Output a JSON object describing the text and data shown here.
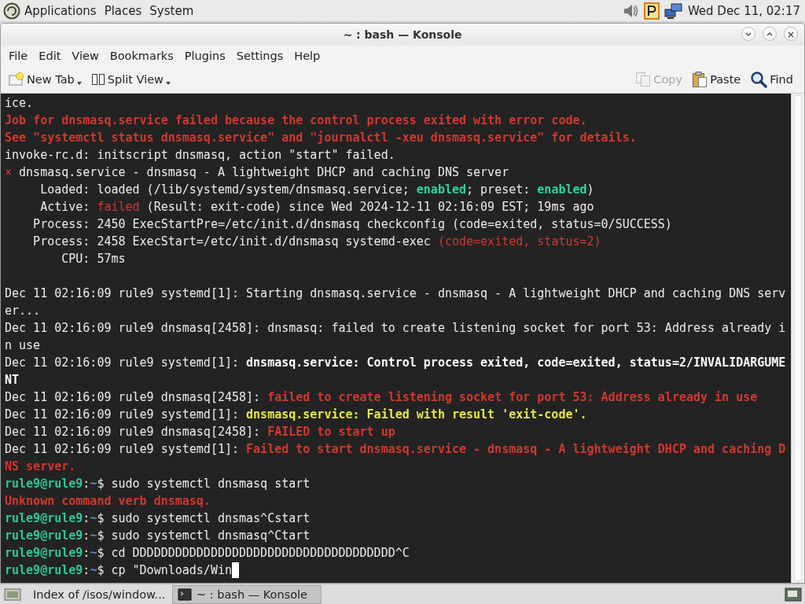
{
  "top_panel": {
    "menus": [
      "Applications",
      "Places",
      "System"
    ],
    "clock": "Wed Dec 11, 02:17"
  },
  "window": {
    "title": "~ : bash — Konsole"
  },
  "menu_bar": [
    "File",
    "Edit",
    "View",
    "Bookmarks",
    "Plugins",
    "Settings",
    "Help"
  ],
  "toolbar": {
    "left": [
      {
        "label": "New Tab",
        "kind": "new-tab",
        "disabled": false
      },
      {
        "label": "Split View",
        "kind": "split",
        "disabled": false
      }
    ],
    "right": [
      {
        "label": "Copy",
        "kind": "copy",
        "disabled": true
      },
      {
        "label": "Paste",
        "kind": "paste",
        "disabled": false
      },
      {
        "label": "Find",
        "kind": "find",
        "disabled": false
      }
    ]
  },
  "terminal": {
    "lines": [
      {
        "kind": "text",
        "segments": [
          {
            "text": "ice.",
            "kind": "normal"
          }
        ]
      },
      {
        "kind": "text",
        "segments": [
          {
            "text": "Job for dnsmasq.service failed because the control process exited with error code.",
            "kind": "error"
          }
        ]
      },
      {
        "kind": "text",
        "segments": [
          {
            "text": "See \"systemctl status dnsmasq.service\" and \"journalctl -xeu dnsmasq.service\" for details.",
            "kind": "error"
          }
        ]
      },
      {
        "kind": "text",
        "segments": [
          {
            "text": "invoke-rc.d: initscript dnsmasq, action \"start\" failed.",
            "kind": "normal"
          }
        ]
      },
      {
        "kind": "text",
        "segments": [
          {
            "text": "×",
            "kind": "mark"
          },
          {
            "text": " dnsmasq.service - dnsmasq - A lightweight DHCP and caching DNS server",
            "kind": "normal"
          }
        ]
      },
      {
        "kind": "text",
        "segments": [
          {
            "text": "     Loaded: loaded (/lib/systemd/system/dnsmasq.service; ",
            "kind": "normal"
          },
          {
            "text": "enabled",
            "kind": "ok"
          },
          {
            "text": "; preset: ",
            "kind": "normal"
          },
          {
            "text": "enabled",
            "kind": "ok"
          },
          {
            "text": ")",
            "kind": "normal"
          }
        ]
      },
      {
        "kind": "text",
        "segments": [
          {
            "text": "     Active: ",
            "kind": "normal"
          },
          {
            "text": "failed",
            "kind": "mark"
          },
          {
            "text": " (Result: exit-code) since Wed 2024-12-11 02:16:09 EST; 19ms ago",
            "kind": "normal"
          }
        ]
      },
      {
        "kind": "text",
        "segments": [
          {
            "text": "    Process: 2450 ExecStartPre=/etc/init.d/dnsmasq checkconfig (code=exited, status=0/SUCCESS)",
            "kind": "normal"
          }
        ]
      },
      {
        "kind": "text",
        "segments": [
          {
            "text": "    Process: 2458 ExecStart=/etc/init.d/dnsmasq systemd-exec ",
            "kind": "normal"
          },
          {
            "text": "(code=exited, status=2)",
            "kind": "mark"
          }
        ]
      },
      {
        "kind": "text",
        "segments": [
          {
            "text": "        CPU: 57ms",
            "kind": "normal"
          }
        ]
      },
      {
        "kind": "blank"
      },
      {
        "kind": "text",
        "segments": [
          {
            "text": "Dec 11 02:16:09 rule9 systemd[1]: Starting dnsmasq.service - dnsmasq - A lightweight DHCP and caching DNS serv",
            "kind": "normal"
          }
        ]
      },
      {
        "kind": "text",
        "segments": [
          {
            "text": "er...",
            "kind": "normal"
          }
        ]
      },
      {
        "kind": "text",
        "segments": [
          {
            "text": "Dec 11 02:16:09 rule9 dnsmasq[2458]: dnsmasq: failed to create listening socket for port 53: Address already i",
            "kind": "normal"
          }
        ]
      },
      {
        "kind": "text",
        "segments": [
          {
            "text": "n use",
            "kind": "normal"
          }
        ]
      },
      {
        "kind": "text",
        "segments": [
          {
            "text": "Dec 11 02:16:09 rule9 systemd[1]: ",
            "kind": "normal"
          },
          {
            "text": "dnsmasq.service: Control process exited, code=exited, status=2/INVALIDARGUME",
            "kind": "bold"
          }
        ]
      },
      {
        "kind": "text",
        "segments": [
          {
            "text": "NT",
            "kind": "bold"
          }
        ]
      },
      {
        "kind": "text",
        "segments": [
          {
            "text": "Dec 11 02:16:09 rule9 dnsmasq[2458]: ",
            "kind": "normal"
          },
          {
            "text": "failed to create listening socket for port 53: Address already in use",
            "kind": "error"
          }
        ]
      },
      {
        "kind": "text",
        "segments": [
          {
            "text": "Dec 11 02:16:09 rule9 systemd[1]: ",
            "kind": "normal"
          },
          {
            "text": "dnsmasq.service: Failed with result 'exit-code'.",
            "kind": "warn"
          }
        ]
      },
      {
        "kind": "text",
        "segments": [
          {
            "text": "Dec 11 02:16:09 rule9 dnsmasq[2458]: ",
            "kind": "normal"
          },
          {
            "text": "FAILED to start up",
            "kind": "error"
          }
        ]
      },
      {
        "kind": "text",
        "segments": [
          {
            "text": "Dec 11 02:16:09 rule9 systemd[1]: ",
            "kind": "normal"
          },
          {
            "text": "Failed to start dnsmasq.service - dnsmasq - A lightweight DHCP and caching D",
            "kind": "error"
          }
        ]
      },
      {
        "kind": "text",
        "segments": [
          {
            "text": "NS server.",
            "kind": "error"
          }
        ]
      },
      {
        "kind": "text",
        "segments": [
          {
            "text": "rule9@rule9",
            "kind": "user"
          },
          {
            "text": ":",
            "kind": "normal"
          },
          {
            "text": "~",
            "kind": "path"
          },
          {
            "text": "$ sudo systemctl dnsmasq start",
            "kind": "normal"
          }
        ]
      },
      {
        "kind": "text",
        "segments": [
          {
            "text": "Unknown command verb dnsmasq.",
            "kind": "error"
          }
        ]
      },
      {
        "kind": "text",
        "segments": [
          {
            "text": "rule9@rule9",
            "kind": "user"
          },
          {
            "text": ":",
            "kind": "normal"
          },
          {
            "text": "~",
            "kind": "path"
          },
          {
            "text": "$ sudo systemctl dnsmas^Cstart",
            "kind": "normal"
          }
        ]
      },
      {
        "kind": "text",
        "segments": [
          {
            "text": "rule9@rule9",
            "kind": "user"
          },
          {
            "text": ":",
            "kind": "normal"
          },
          {
            "text": "~",
            "kind": "path"
          },
          {
            "text": "$ sudo systemctl dnsmasq^Ctart",
            "kind": "normal"
          }
        ]
      },
      {
        "kind": "text",
        "segments": [
          {
            "text": "rule9@rule9",
            "kind": "user"
          },
          {
            "text": ":",
            "kind": "normal"
          },
          {
            "text": "~",
            "kind": "path"
          },
          {
            "text": "$ cd DDDDDDDDDDDDDDDDDDDDDDDDDDDDDDDDDDDDD^C",
            "kind": "normal"
          }
        ]
      },
      {
        "kind": "input",
        "segments": [
          {
            "text": "rule9@rule9",
            "kind": "user"
          },
          {
            "text": ":",
            "kind": "normal"
          },
          {
            "text": "~",
            "kind": "path"
          },
          {
            "text": "$ cp \"Downloads/Win",
            "kind": "normal"
          }
        ]
      }
    ]
  },
  "taskbar": {
    "tasks": [
      {
        "label": "Index of /isos/window...",
        "kind": "browser",
        "selected": false
      },
      {
        "label": "~ : bash — Konsole",
        "kind": "terminal",
        "selected": true
      }
    ]
  }
}
